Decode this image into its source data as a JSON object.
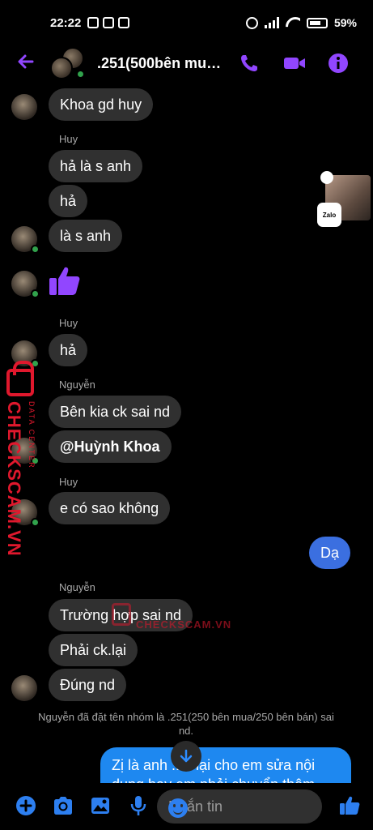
{
  "status_bar": {
    "time": "22:22",
    "battery": "59%"
  },
  "header": {
    "title": ".251(500bên mua..."
  },
  "messages": [
    {
      "text": "Khoa gd huy"
    },
    {
      "sender": "Huy",
      "text": "hả là s anh"
    },
    {
      "text": "hả"
    },
    {
      "text": "là s anh"
    },
    {
      "sender": "Huy",
      "text": "hả"
    },
    {
      "sender": "Nguyễn",
      "text": "Bên kia ck sai nd"
    },
    {
      "text": "@Huỳnh Khoa"
    },
    {
      "sender": "Huy",
      "text": "e có sao không"
    },
    {
      "text": "Dạ"
    },
    {
      "sender": "Nguyễn",
      "text": "Trường hợp sai nd"
    },
    {
      "text": "Phải ck.lại"
    },
    {
      "text": "Đúng nd"
    }
  ],
  "system_message": "Nguyễn đã đặt tên nhóm là .251(250 bên mua/250 bên bán) sai nd.",
  "outgoing_long": "Zị là anh ...n lại cho em sửa nội dung hay em phải chuyển thêm",
  "composer": {
    "placeholder": "Nhắn tin"
  },
  "floating_badge": "Zalo",
  "watermark": {
    "main": "CHECKSCAM.VN",
    "sub": "DATA CENTER",
    "center": "CHECKSCAM.VN"
  },
  "colors": {
    "accent": "#9146ff",
    "outgoing_bubble": "#3b6fe0",
    "incoming_bubble": "#303030",
    "online": "#31a24c",
    "watermark": "#e0182d"
  }
}
